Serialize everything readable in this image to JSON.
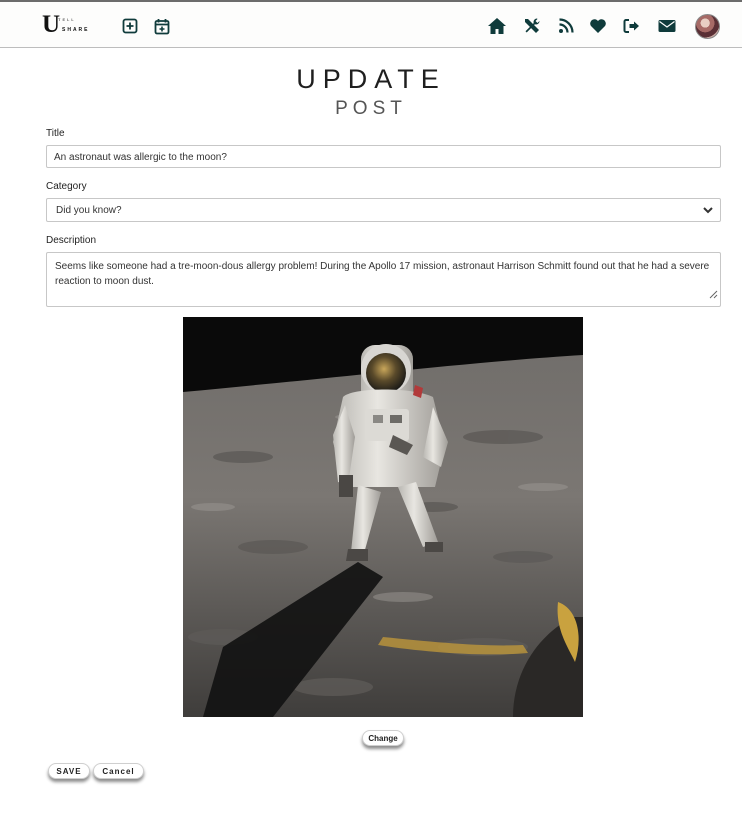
{
  "navbar": {
    "logo": {
      "big": "U",
      "sub": "SHARE",
      "small": "TELL"
    },
    "left_icons": [
      "add-post-icon",
      "calendar-add-icon"
    ],
    "right_icons": [
      "home-icon",
      "tools-icon",
      "rss-feed-icon",
      "heart-icon",
      "logout-icon",
      "envelope-icon"
    ],
    "accent": "#0f3b3b"
  },
  "page": {
    "title": "UPDATE",
    "subtitle": "POST"
  },
  "form": {
    "title_label": "Title",
    "title_value": "An astronaut was allergic to the moon?",
    "category_label": "Category",
    "category_value": "Did you know?",
    "description_label": "Description",
    "description_value": "Seems like someone had a tre-moon-dous allergy problem! During the Apollo 17 mission, astronaut Harrison Schmitt found out that he had a severe reaction to moon dust."
  },
  "image": {
    "subject": "astronaut-on-moon-photo"
  },
  "buttons": {
    "change": "Change",
    "save": "SAVE",
    "cancel": "Cancel"
  }
}
